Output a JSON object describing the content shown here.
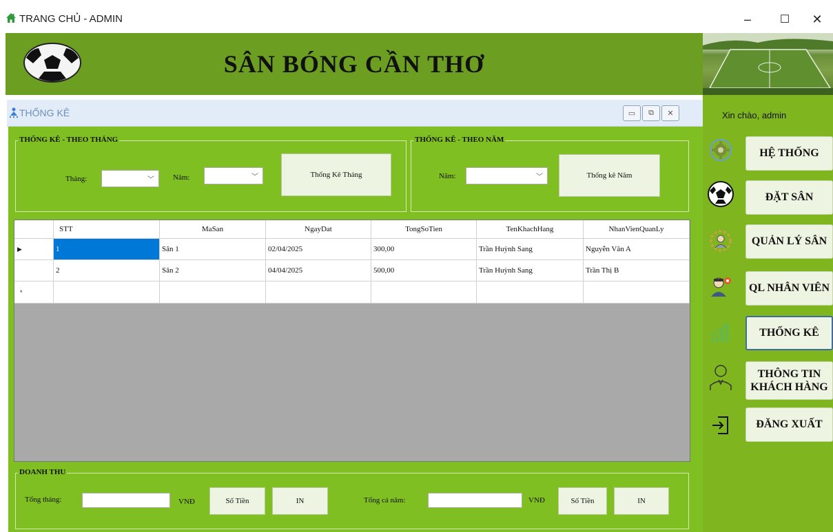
{
  "window": {
    "title": "TRANG CHỦ - ADMIN",
    "minimize": "–",
    "maximize": "☐",
    "close": "✕"
  },
  "header": {
    "brand": "SÂN BÓNG CẦN THƠ"
  },
  "child": {
    "title": "THỐNG KÊ",
    "buttons": {
      "minimize": "▭",
      "restore": "⧉",
      "close": "✕"
    },
    "month_group": {
      "title": "THỐNG KÊ - THEO THÁNG",
      "month_label": "Tháng:",
      "year_label": "Năm:",
      "button": "Thống Kê Tháng"
    },
    "year_group": {
      "title": "THỐNG KÊ - THEO NĂM",
      "year_label": "Năm:",
      "button": "Thống kê Năm"
    },
    "grid": {
      "columns": [
        "STT",
        "MaSan",
        "NgayDat",
        "TongSoTien",
        "TenKhachHang",
        "NhanVienQuanLy"
      ],
      "rows": [
        [
          "1",
          "Sân 1",
          "02/04/2025",
          "300,00",
          "Trần Huỳnh Sang",
          "Nguyễn Văn A"
        ],
        [
          "2",
          "Sân 2",
          "04/04/2025",
          "500,00",
          "Trần Huỳnh Sang",
          "Trần Thị B"
        ]
      ],
      "current_row_marker": "▶",
      "new_row_marker": "*"
    },
    "revenue": {
      "title": "DOANH THU",
      "month_total_label": "Tổng tháng:",
      "currency": "VNĐ",
      "amount_button": "Số Tiền",
      "print_button": "IN",
      "year_total_label": "Tổng cả năm:",
      "currency_year": "VNĐ",
      "amount_button_year": "Số Tiền",
      "print_button_year": "IN"
    }
  },
  "sidebar": {
    "greeting": "Xin chào, admin",
    "items": [
      {
        "label": "HỆ THỐNG",
        "icon": "gear-icon"
      },
      {
        "label": "ĐẶT SÂN",
        "icon": "soccer-ball-icon"
      },
      {
        "label": "QUẢN LÝ SÂN",
        "icon": "manager-gear-icon"
      },
      {
        "label": "QL NHÂN VIÊN",
        "icon": "staff-icon"
      },
      {
        "label": "THỐNG KÊ",
        "icon": "chart-icon",
        "active": true
      },
      {
        "label": "THÔNG TIN KHÁCH HÀNG",
        "icon": "customer-icon"
      },
      {
        "label": "ĐĂNG XUẤT",
        "icon": "logout-icon"
      }
    ]
  },
  "colors": {
    "header_green": "#6c9e22",
    "panel_green": "#7fb51f",
    "form_green": "#7fbf22",
    "selection_blue": "#0078d7"
  }
}
